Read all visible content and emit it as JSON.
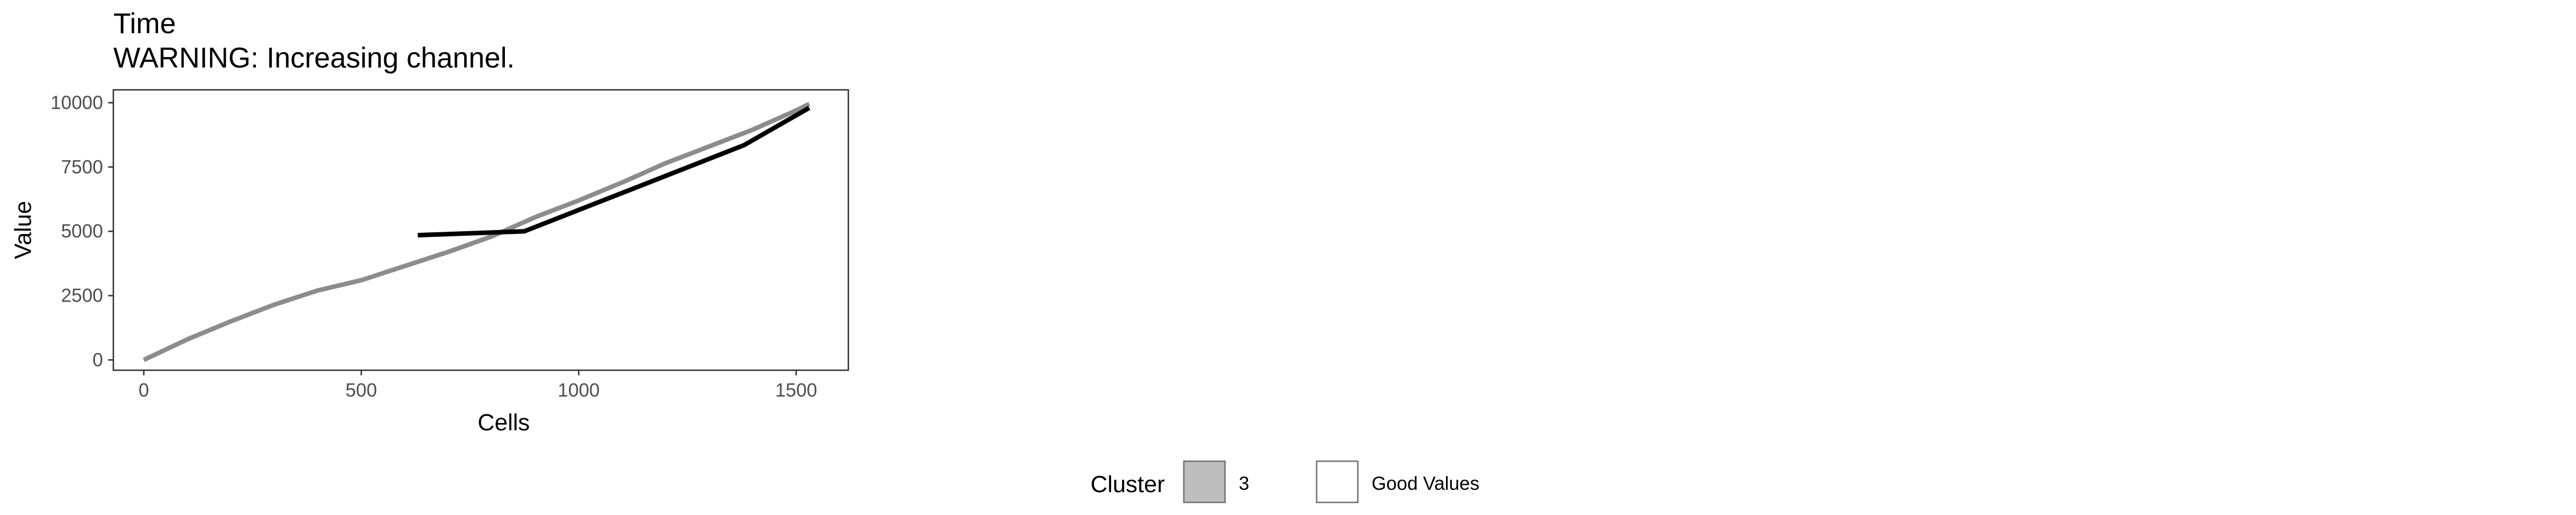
{
  "chart_data": {
    "type": "line",
    "title": "Time",
    "subtitle": "WARNING: Increasing channel.",
    "xlabel": "Cells",
    "ylabel": "Value",
    "xlim": [
      -70,
      1620
    ],
    "ylim": [
      -400,
      10500
    ],
    "x_ticks": [
      0,
      500,
      1000,
      1500
    ],
    "y_ticks": [
      0,
      2500,
      5000,
      7500,
      10000
    ],
    "x_tick_labels": [
      "0",
      "500",
      "1000",
      "1500"
    ],
    "y_tick_labels": [
      "0",
      "2500",
      "5000",
      "7500",
      "10000"
    ],
    "grid": false,
    "legend_position": "bottom",
    "series": [
      {
        "key": "cluster-3",
        "color": "#8c8c8c",
        "x": [
          0,
          50,
          100,
          200,
          300,
          400,
          500,
          600,
          700,
          800,
          900,
          1000,
          1100,
          1200,
          1300,
          1400,
          1500,
          1530
        ],
        "y": [
          0,
          400,
          800,
          1500,
          2150,
          2700,
          3100,
          3650,
          4200,
          4800,
          5550,
          6200,
          6900,
          7650,
          8300,
          8950,
          9700,
          9950
        ]
      },
      {
        "key": "good-values",
        "color": "#000000",
        "x": [
          630,
          875,
          1380,
          1530
        ],
        "y": [
          4850,
          5000,
          8350,
          9800
        ]
      }
    ]
  },
  "legend": {
    "title": "Cluster",
    "items": [
      {
        "label": "3",
        "fill": "#bebebe"
      },
      {
        "label": "Good Values",
        "fill": "#ffffff"
      }
    ]
  }
}
